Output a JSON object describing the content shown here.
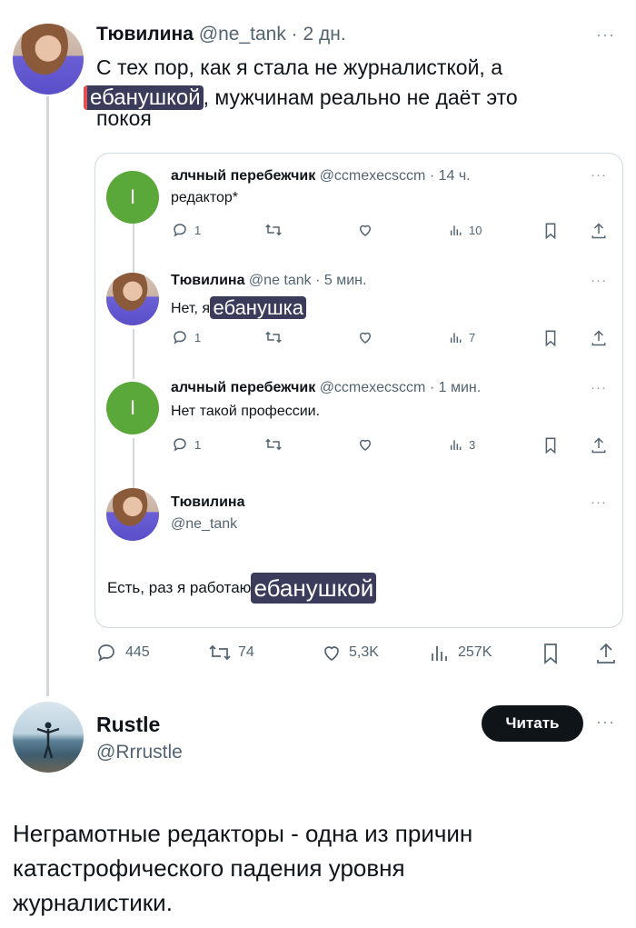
{
  "main_tweet": {
    "author_name": "Тювилина",
    "handle_time": "@ne_tank · 2 дн.",
    "text_line1": "С тех пор, как я стала не журналисткой, а",
    "text_highlight": "ебанушкой",
    "text_line2_rest": ", мужчинам реально не даёт это",
    "text_line3": "покоя",
    "more": "···",
    "stats": {
      "replies": "445",
      "retweets": "74",
      "likes": "5,3K",
      "views": "257K"
    }
  },
  "quote": {
    "t1": {
      "name": "алчный перебежчик",
      "meta": "@ccmexecsccm · 14 ч.",
      "text": "редактор*",
      "avatar_letter": "I",
      "replies": "1",
      "views": "10",
      "more": "···"
    },
    "t2": {
      "name": "Тювилина",
      "meta": "@ne tank · 5 мин.",
      "text_prefix": "Нет, я",
      "highlight": "ебанушка",
      "replies": "1",
      "views": "7",
      "more": "···"
    },
    "t3": {
      "name": "алчный перебежчик",
      "meta": "@ccmexecsccm · 1 мин.",
      "text": "Нет такой профессии.",
      "avatar_letter": "I",
      "replies": "1",
      "views": "3",
      "more": "···"
    },
    "t4": {
      "name": "Тювилина",
      "handle": "@ne_tank",
      "text_prefix": "Есть, раз я работаю",
      "highlight": "ебанушкой",
      "more": "···"
    }
  },
  "reply_tweet": {
    "author_name": "Rustle",
    "handle": "@Rrrustle",
    "follow_label": "Читать",
    "more": "···",
    "text_line1": "Неграмотные редакторы - одна из причин",
    "text_line2": "катастрофического падения уровня",
    "text_line3": "журналистики."
  },
  "icons": [
    "reply-icon",
    "retweet-icon",
    "like-icon",
    "views-icon",
    "bookmark-icon",
    "share-icon",
    "more-icon"
  ]
}
